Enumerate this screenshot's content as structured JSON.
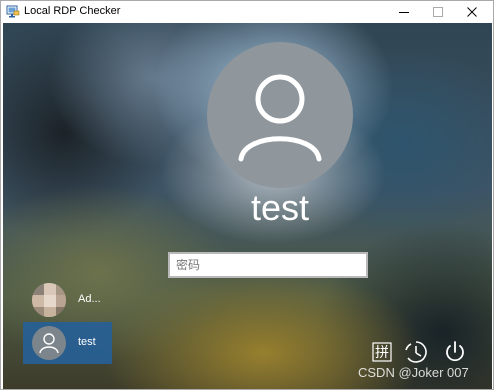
{
  "window": {
    "title": "Local RDP Checker",
    "icon": "rdp-app-icon",
    "controls": [
      "minimize-icon",
      "maximize-icon",
      "close-icon"
    ]
  },
  "login": {
    "username": "test",
    "password_placeholder": "密码",
    "password_value": ""
  },
  "user_list": [
    {
      "label": "Ad...",
      "avatar": "blurred-photo-avatar",
      "selected": false
    },
    {
      "label": "test",
      "avatar": "user-icon",
      "selected": true
    }
  ],
  "system_icons": {
    "ime": "拼",
    "accessibility": "ease-of-access-icon",
    "power": "power-icon"
  },
  "watermark": "CSDN @Joker 007",
  "colors": {
    "selected_user_bg": "#2660a0",
    "text": "#ffffff"
  }
}
